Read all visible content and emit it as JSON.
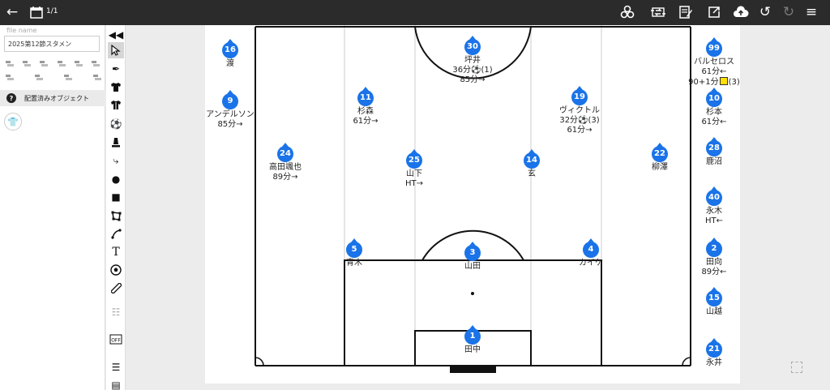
{
  "topbar": {
    "page_count": "1/1",
    "icons": [
      "back-arrow-icon",
      "calendar-icon",
      "share-nodes-icon",
      "swap-icon",
      "edit-note-icon",
      "export-icon",
      "cloud-upload-icon",
      "undo-icon",
      "redo-icon",
      "menu-icon"
    ]
  },
  "file": {
    "label": "file name",
    "value": "2025第12節スタメン"
  },
  "placed_objects": {
    "label": "配置済みオブジェクト"
  },
  "colors": {
    "player_badge": "#1a73e8",
    "topbar": "#2b2b2b",
    "yellow_card": "#ffe000"
  },
  "players": [
    {
      "id": "p16",
      "number": "16",
      "name": "渡",
      "sub": ""
    },
    {
      "id": "p9",
      "number": "9",
      "name": "アンデルソン",
      "sub": "85分→"
    },
    {
      "id": "p30",
      "number": "30",
      "name": "坪井",
      "sub": "36分⚽(1)",
      "sub2": "85分→"
    },
    {
      "id": "p11",
      "number": "11",
      "name": "杉森",
      "sub": "61分→"
    },
    {
      "id": "p19",
      "number": "19",
      "name": "ヴィクトル",
      "sub": "32分⚽(3)",
      "sub2": "61分→"
    },
    {
      "id": "p24",
      "number": "24",
      "name": "高田颯也",
      "sub": "89分→"
    },
    {
      "id": "p25",
      "number": "25",
      "name": "山下",
      "sub": "HT→"
    },
    {
      "id": "p14",
      "number": "14",
      "name": "玄",
      "sub": ""
    },
    {
      "id": "p22",
      "number": "22",
      "name": "柳澤",
      "sub": ""
    },
    {
      "id": "p5",
      "number": "5",
      "name": "青木",
      "sub": ""
    },
    {
      "id": "p3",
      "number": "3",
      "name": "山田",
      "sub": ""
    },
    {
      "id": "p4",
      "number": "4",
      "name": "カイケ",
      "sub": ""
    },
    {
      "id": "p1",
      "number": "1",
      "name": "田中",
      "sub": ""
    },
    {
      "id": "p99",
      "number": "99",
      "name": "バルセロス",
      "sub": "61分←",
      "sub2": "90+1分",
      "sub2b": "(3)"
    },
    {
      "id": "p10",
      "number": "10",
      "name": "杉本",
      "sub": "61分←"
    },
    {
      "id": "p28",
      "number": "28",
      "name": "鹿沼",
      "sub": ""
    },
    {
      "id": "p40",
      "number": "40",
      "name": "永木",
      "sub": "HT←"
    },
    {
      "id": "p2",
      "number": "2",
      "name": "田向",
      "sub": "89分←"
    },
    {
      "id": "p15",
      "number": "15",
      "name": "山越",
      "sub": ""
    },
    {
      "id": "p21",
      "number": "21",
      "name": "永井",
      "sub": ""
    }
  ]
}
